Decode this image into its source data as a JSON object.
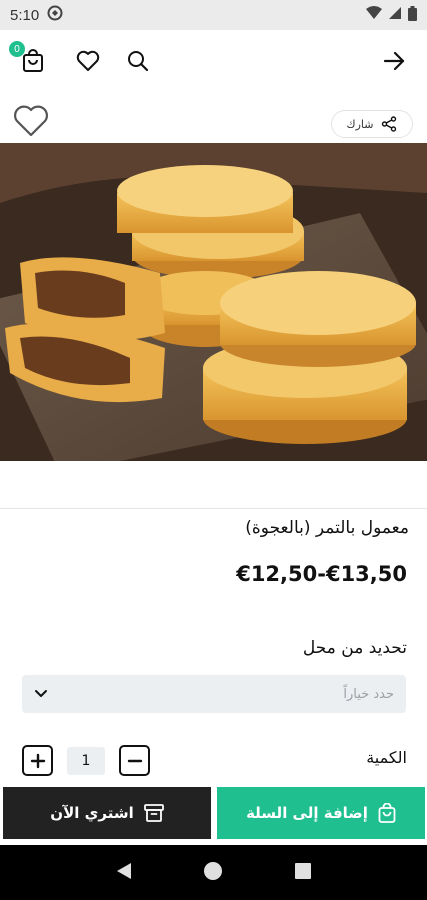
{
  "status_bar": {
    "time": "5:10"
  },
  "header": {
    "cart_count": "0"
  },
  "share": {
    "label": "شارك"
  },
  "product": {
    "title": "معمول بالتمر (بالعجوة)",
    "price": "€12,50-€13,50"
  },
  "location": {
    "label": "تحديد من محل",
    "placeholder": "حدد خياراً"
  },
  "quantity": {
    "label": "الكمية",
    "value": "1"
  },
  "actions": {
    "add_to_cart": "إضافة إلى السلة",
    "buy_now": "اشتري الآن"
  },
  "colors": {
    "accent": "#1fbf8f",
    "dark": "#222222"
  }
}
